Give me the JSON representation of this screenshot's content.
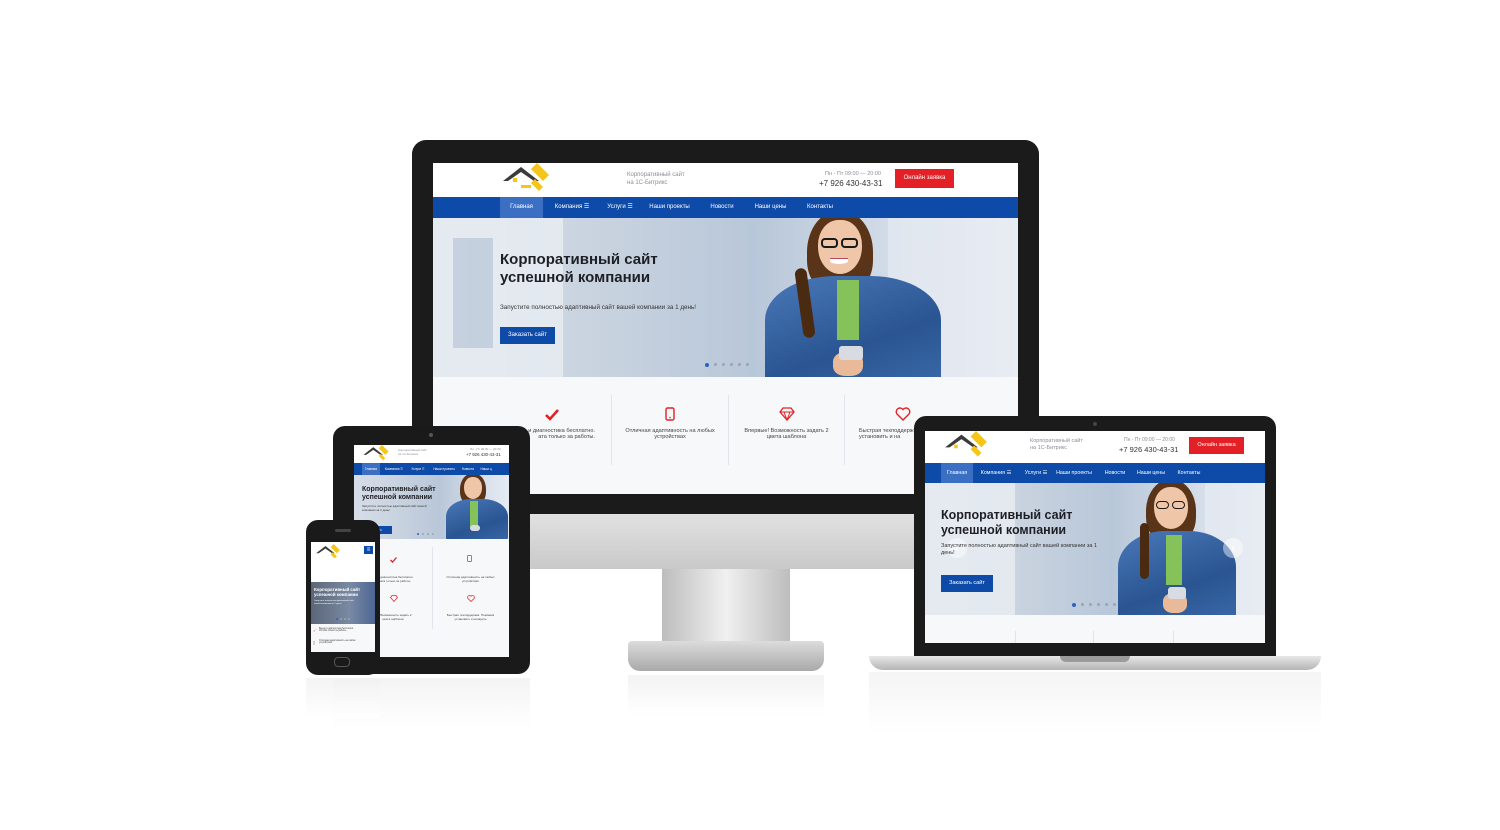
{
  "brand": {
    "tagline_line1": "Корпоративный сайт",
    "tagline_line2": "на 1С-Битрикс",
    "hours": "Пн - Пт 09:00 — 20:00",
    "phone": "+7 926 430-43-31",
    "request_button": "Онлайн заявка"
  },
  "nav": {
    "items": [
      "Главная",
      "Компания ☰",
      "Услуги ☰",
      "Наши проекты",
      "Новости",
      "Наши цены",
      "Контакты"
    ]
  },
  "tablet_nav": {
    "items": [
      "Главная",
      "Компания ☰",
      "Услуги ☰",
      "Наши проекты",
      "Новости",
      "Наши ц"
    ]
  },
  "hero": {
    "title_line1": "Корпоративный сайт",
    "title_line2": "успешной компании",
    "subtitle": "Запустите полностью адаптивный сайт вашей компании за 1 день!",
    "laptop_subtitle_line1": "Запустите полностью адаптивный сайт вашей компании за 1",
    "laptop_subtitle_line2": "день!",
    "tablet_subtitle_line1": "Запустите полностью адаптивный сайт вашей",
    "tablet_subtitle_line2": "компании за 1 день!",
    "phone_subtitle_line1": "Запустите полностью адаптивный сайт",
    "phone_subtitle_line2": "вашей компании за 1 день!",
    "button": "Заказать сайт",
    "tablet_button": "сайт"
  },
  "features": {
    "imac": [
      {
        "icon": "check-icon",
        "line1": "и диагностика бесплатно.",
        "line2": "ата только за работы."
      },
      {
        "icon": "tablet-icon",
        "line1": "Отличная адаптивность на любых",
        "line2": "устройствах"
      },
      {
        "icon": "diamond-icon",
        "line1": "Впервые! Возможность задать 2",
        "line2": "цвета шаблона"
      },
      {
        "icon": "heart-icon",
        "line1": "Быстрая техподдерж",
        "line2": "установить и на"
      }
    ],
    "tablet": [
      {
        "icon": "check-icon",
        "line1": "...д и диагностика бесплатно.",
        "line2": "Оплата только за работы."
      },
      {
        "icon": "tablet-icon",
        "line1": "Отличная адаптивность на любых",
        "line2": "устройствах"
      },
      {
        "icon": "diamond-icon",
        "line1": "...е! Возможность задать 2",
        "line2": "цвета шаблона"
      },
      {
        "icon": "heart-icon",
        "line1": "Быстрая техподдержка. Поможем",
        "line2": "установить и наладить"
      }
    ],
    "phone": [
      {
        "icon": "check-icon",
        "line1": "Выезд и диагностика бесплатно.",
        "line2": "Оплата только за работы."
      },
      {
        "icon": "tablet-icon",
        "line1": "Отличная адаптивность на любых",
        "line2": "устройствах"
      }
    ]
  },
  "slider": {
    "slide_count": 6,
    "active_index": 0
  },
  "colors": {
    "nav_blue": "#0e4aa8",
    "accent_red": "#e32025",
    "logo_yellow": "#f5c518"
  }
}
